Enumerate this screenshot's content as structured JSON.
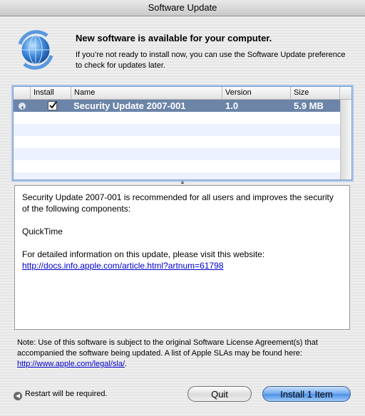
{
  "window": {
    "title": "Software Update"
  },
  "header": {
    "headline": "New software is available for your computer.",
    "subtext": "If you’re not ready to install now, you can use the Software Update preference to check for updates later."
  },
  "table": {
    "columns": {
      "install": "Install",
      "name": "Name",
      "version": "Version",
      "size": "Size"
    },
    "rows": [
      {
        "install": true,
        "name": "Security Update 2007-001",
        "version": "1.0",
        "size": "5.9 MB"
      }
    ]
  },
  "description": {
    "intro": "Security Update 2007-001 is recommended for all users and improves the security of the following components:",
    "component": "QuickTime",
    "info": "For detailed information on this update, please visit this website:",
    "link": "http://docs.info.apple.com/article.html?artnum=61798"
  },
  "note": {
    "text": "Note: Use of this software is subject to the original Software License Agreement(s) that accompanied the software being updated. A list of Apple SLAs may be found here:",
    "link": "http://www.apple.com/legal/sla/",
    "suffix": "."
  },
  "footer": {
    "restart_notice": "Restart will be required.",
    "quit_label": "Quit",
    "install_label": "Install 1 Item"
  },
  "colors": {
    "selection": "#6b84a8",
    "link": "#0000cc",
    "default_button": "#4d8fe6"
  },
  "icons": [
    "software-update-icon",
    "checkbox-checked-icon",
    "disclosure-icon",
    "splitter-handle-icon",
    "restart-icon"
  ]
}
